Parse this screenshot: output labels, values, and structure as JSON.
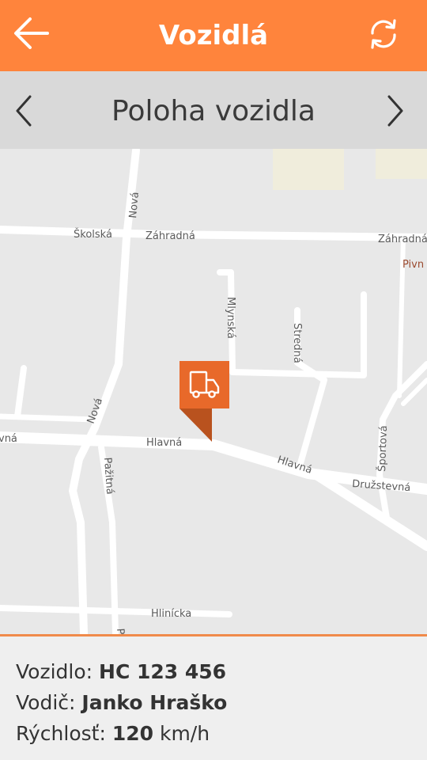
{
  "appbar": {
    "title": "Vozidlá"
  },
  "subbar": {
    "title": "Poloha vozidla"
  },
  "map": {
    "streets": {
      "nova_top": "Nová",
      "skolska": "Školská",
      "zahradna_left": "Záhradná",
      "zahradna_right": "Záhradná",
      "mlynska": "Mlynská",
      "stredna": "Stredná",
      "nova_mid": "Nová",
      "hlavna_left_cut": "vná",
      "hlavna_mid": "Hlavná",
      "hlavna_right": "Hlavná",
      "druzstevna": "Družstevná",
      "sportova": "Športová",
      "pazitna": "Pažitná",
      "hlinicka": "Hlinícka",
      "pazitna_cut": "P"
    },
    "poi": "Pivn",
    "marker": {
      "icon": "truck-icon",
      "color": "#e8692a"
    }
  },
  "info": {
    "vehicle_label": "Vozidlo: ",
    "vehicle_value": "HC 123 456",
    "driver_label": "Vodič: ",
    "driver_value": "Janko Hraško",
    "speed_label": "Rýchlosť: ",
    "speed_value": "120",
    "speed_unit": " km/h"
  },
  "colors": {
    "accent": "#ff843c",
    "subbar": "#d9d9d9",
    "map_bg": "#e8e8e8",
    "road": "#ffffff"
  }
}
